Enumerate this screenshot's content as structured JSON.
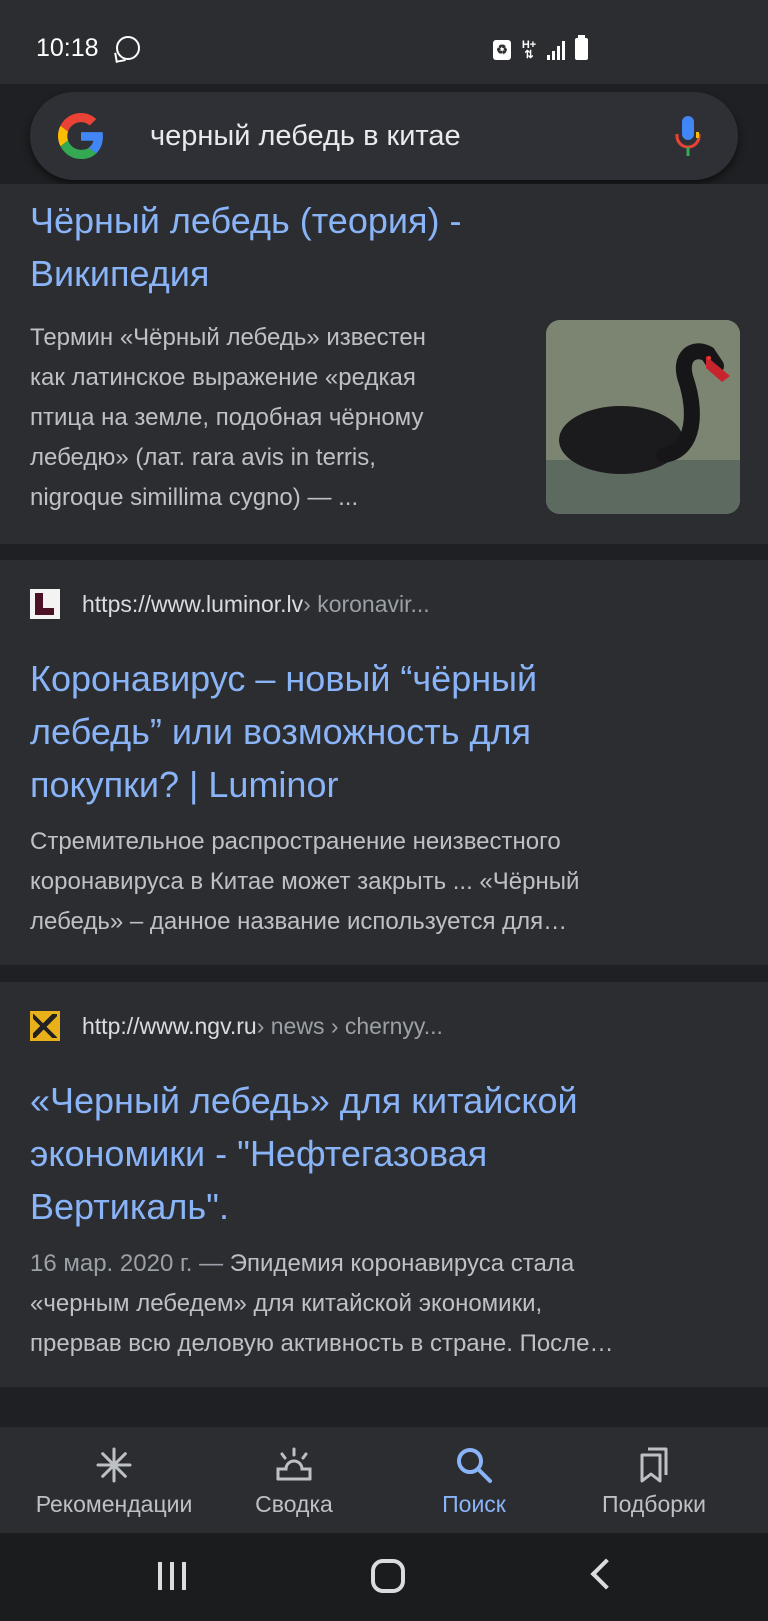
{
  "status_bar": {
    "time": "10:18",
    "icons": [
      "whatsapp-icon",
      "recycle-icon",
      "data-arrows-icon",
      "signal-icon",
      "battery-icon"
    ]
  },
  "search": {
    "query": "черный лебедь в китае",
    "logo": "google-g-logo",
    "mic": "microphone-icon"
  },
  "results": [
    {
      "title_lines": [
        "Чёрный лебедь (теория) -",
        "Википедия"
      ],
      "snippet_lines": [
        "Термин «Чёрный лебедь» известен",
        "как латинское выражение «редкая",
        "птица на земле, подобная чёрному",
        "лебедю» (лат. rara avis in terris,",
        "nigroque simillima cygno) — ..."
      ],
      "thumbnail": "black-swan-photo"
    },
    {
      "source_url": "https://www.luminor.lv",
      "source_path": " › koronavir...",
      "title_lines": [
        "Коронавирус – новый “чёрный",
        "лебедь” или возможность для",
        "покупки? | Luminor"
      ],
      "snippet_lines": [
        "Стремительное распространение неизвестного",
        "коронавируса в Китае может закрыть ... «Чёрный",
        "лебедь» – данное название используется для…"
      ]
    },
    {
      "source_url": "http://www.ngv.ru",
      "source_path": " › news › chernyy...",
      "title_lines": [
        "«Черный лебедь» для китайской",
        "экономики - \"Нефтегазовая",
        "Вертикаль\"."
      ],
      "date": "16 мар. 2020 г. — ",
      "snippet_lines": [
        "Эпидемия коронавируса стала",
        "«черным лебедем» для китайской экономики,",
        "прервав всю деловую активность в стране. После…"
      ]
    }
  ],
  "bottom_nav": [
    {
      "label": "Рекомендации",
      "icon": "asterisk-icon",
      "active": false
    },
    {
      "label": "Сводка",
      "icon": "sunrise-icon",
      "active": false
    },
    {
      "label": "Поиск",
      "icon": "search-icon",
      "active": true
    },
    {
      "label": "Подборки",
      "icon": "bookmarks-icon",
      "active": false
    }
  ],
  "system_nav": [
    "recents-button",
    "home-button",
    "back-button"
  ],
  "colors": {
    "background": "#1f2023",
    "card": "#2c2d31",
    "link": "#8ab4f8",
    "snippet": "#bdc1c6"
  }
}
